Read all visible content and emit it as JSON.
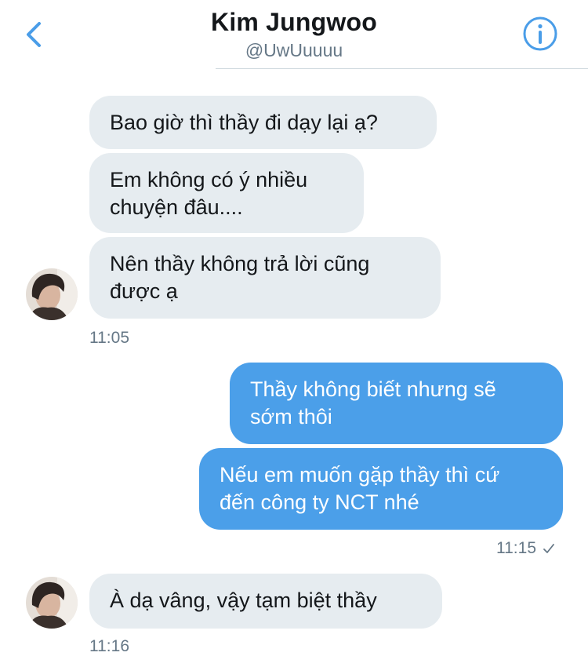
{
  "header": {
    "name": "Kim Jungwoo",
    "handle": "@UwUuuuu",
    "back_icon": "chevron-left-icon",
    "info_icon": "info-icon",
    "accent": "#4a9de8"
  },
  "messages": [
    {
      "side": "incoming",
      "text": "Bao giờ thì thầy đi dạy lại ạ?"
    },
    {
      "side": "incoming",
      "text": "Em không có ý nhiều\nchuyện đâu...."
    },
    {
      "side": "incoming",
      "text": "Nên thầy không trả lời cũng\nđược ạ"
    },
    {
      "side": "outgoing",
      "text": "Thầy không biết nhưng sẽ\nsớm thôi"
    },
    {
      "side": "outgoing",
      "text": "Nếu em muốn gặp thầy thì cứ\nđến công ty NCT nhé"
    },
    {
      "side": "incoming",
      "text": "À dạ vâng, vậy tạm biệt thầy"
    }
  ],
  "timestamps": {
    "group1": "11:05",
    "group2": "11:15",
    "group3": "11:16"
  },
  "colors": {
    "incoming_bubble": "#e6ecf0",
    "outgoing_bubble": "#4b9fe9",
    "timestamp": "#657786"
  }
}
